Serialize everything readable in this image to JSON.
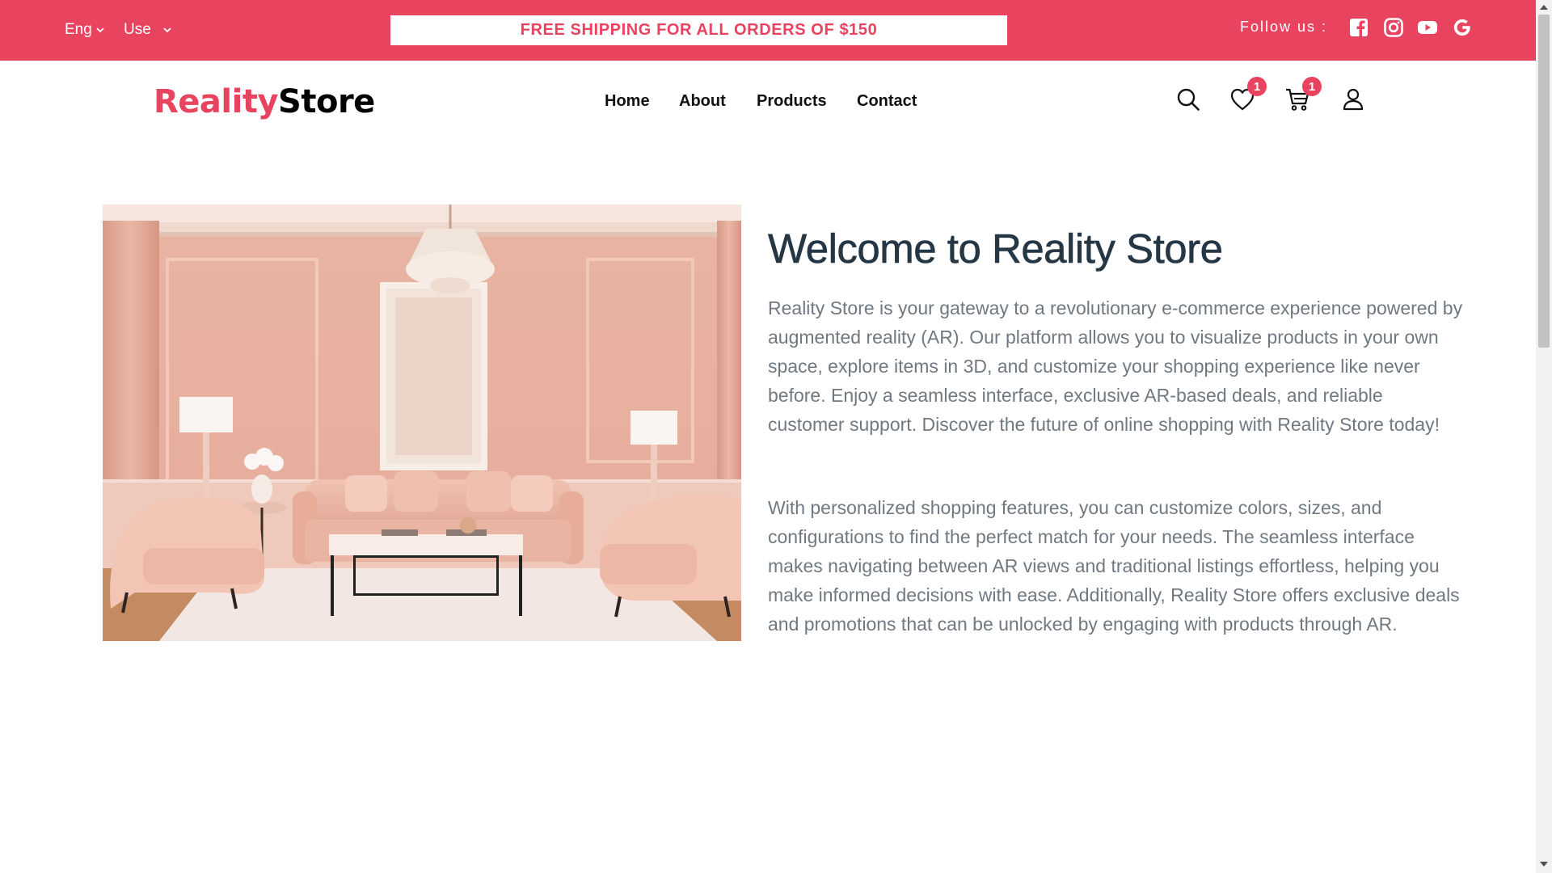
{
  "topbar": {
    "language": "Eng",
    "currency": "Use",
    "promo": "FREE SHIPPING FOR ALL ORDERS OF $150",
    "follow_label": "Follow us :",
    "social_icons": [
      "facebook-icon",
      "instagram-icon",
      "youtube-icon",
      "google-icon"
    ],
    "accent_color": "#e8435f"
  },
  "header": {
    "logo_part1": "Reality",
    "logo_part2": "Store",
    "nav": [
      "Home",
      "About",
      "Products",
      "Contact"
    ],
    "wishlist_count": "1",
    "cart_count": "1",
    "icons": [
      "search-icon",
      "heart-icon",
      "cart-icon",
      "user-icon"
    ]
  },
  "hero": {
    "title": "Welcome to Reality Store",
    "paragraph1": "Reality Store is your gateway to a revolutionary e-commerce experience powered by augmented reality (AR). Our platform allows you to visualize products in your own space, explore items in 3D, and customize your shopping experience like never before. Enjoy a seamless interface, exclusive AR-based deals, and reliable customer support. Discover the future of online shopping with Reality Store today!",
    "paragraph2": "With personalized shopping features, you can customize colors, sizes, and configurations to find the perfect match for your needs. The seamless interface makes navigating between AR views and traditional listings effortless, helping you make informed decisions with ease. Additionally, Reality Store offers exclusive deals and promotions that can be unlocked by engaging with products through AR.",
    "title_color": "#253645",
    "text_color": "#707880"
  }
}
